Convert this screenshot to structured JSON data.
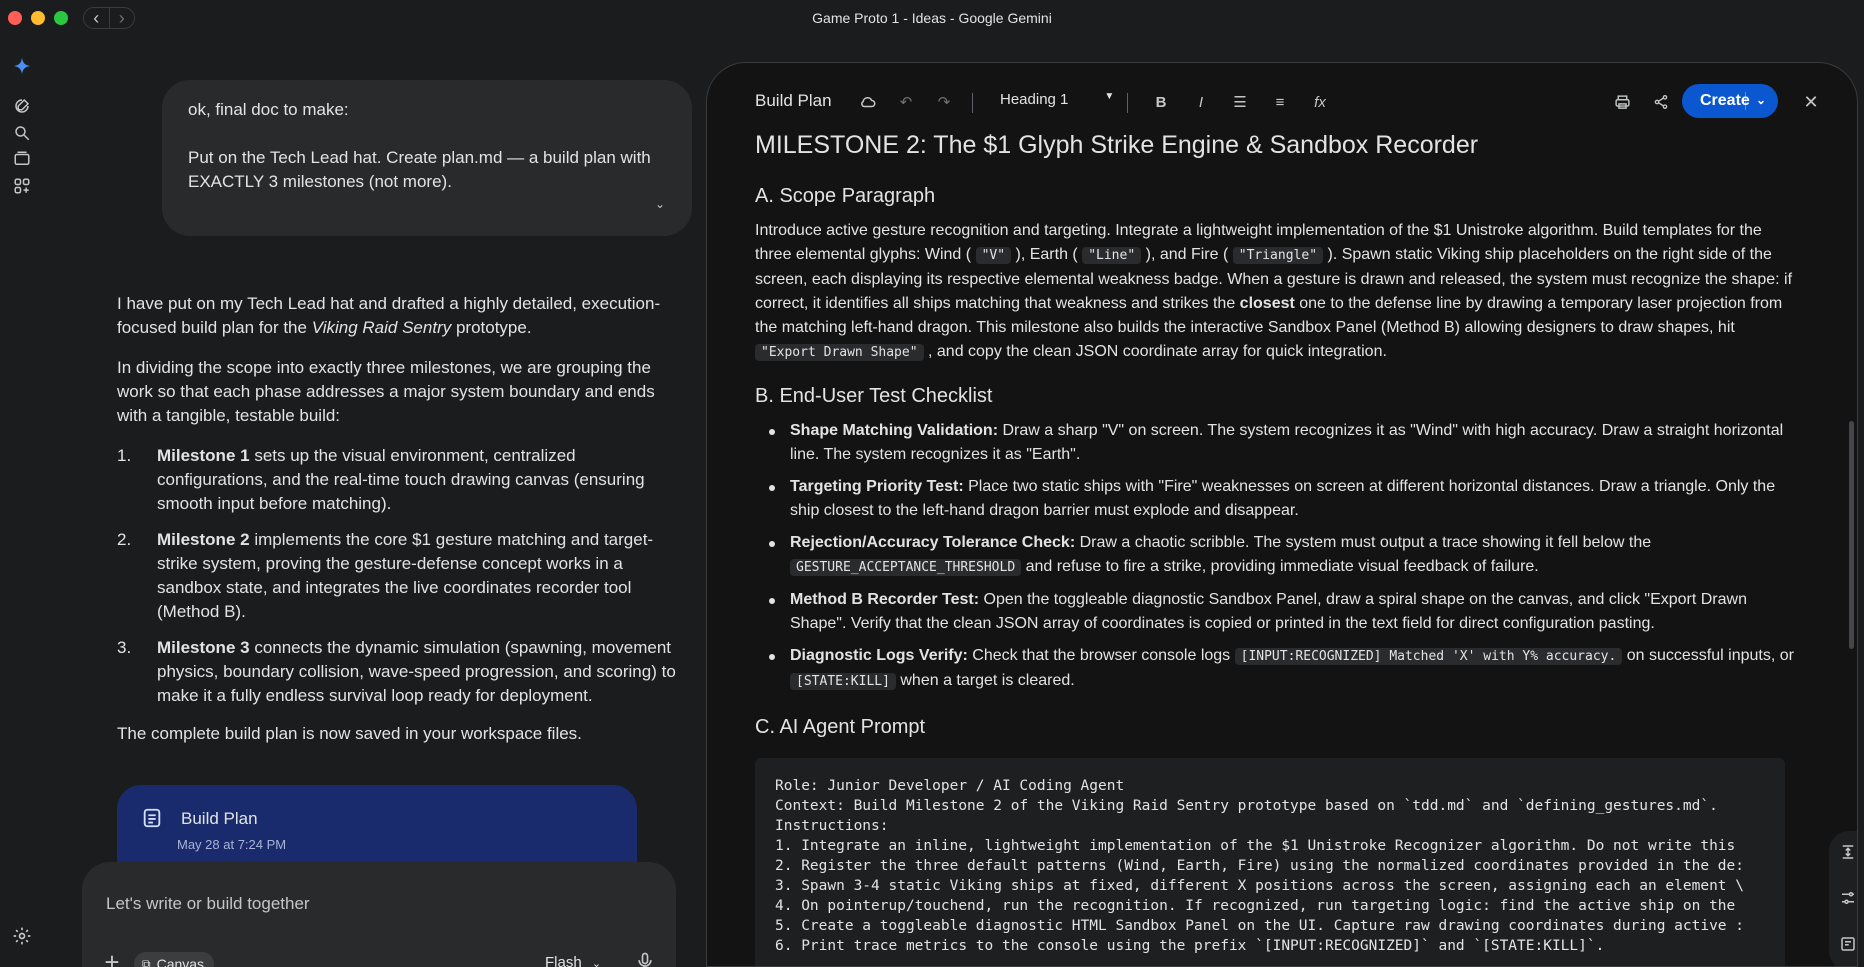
{
  "window": {
    "title": "Game Proto 1 - Ideas - Google Gemini"
  },
  "rail": {
    "icons": [
      "gemini-spark-icon",
      "new-chat-icon",
      "search-icon",
      "library-icon",
      "apps-icon",
      "settings-icon"
    ]
  },
  "chat": {
    "user_message": {
      "line1": "ok, final doc to make:",
      "line2": "Put on the Tech Lead hat. Create plan.md — a build plan with EXACTLY 3 milestones (not more)."
    },
    "response": {
      "intro_prefix": "I have put on my Tech Lead hat and drafted a highly detailed, execution-focused build plan for the ",
      "intro_italic": "Viking Raid Sentry",
      "intro_suffix": " prototype.",
      "para2": "In dividing the scope into exactly three milestones, we are grouping the work so that each phase addresses a major system boundary and ends with a tangible, testable build:",
      "milestones": [
        {
          "num": "1.",
          "title": "Milestone 1",
          "text": " sets up the visual environment, centralized configurations, and the real-time touch drawing canvas (ensuring smooth input before matching)."
        },
        {
          "num": "2.",
          "title": "Milestone 2",
          "text": " implements the core $1 gesture matching and target-strike system, proving the gesture-defense concept works in a sandbox state, and integrates the live coordinates recorder tool (Method B)."
        },
        {
          "num": "3.",
          "title": "Milestone 3",
          "text": " connects the dynamic simulation (spawning, movement physics, boundary collision, wave-speed progression, and scoring) to make it a fully endless survival loop ready for deployment."
        }
      ],
      "closing": "The complete build plan is now saved in your workspace files."
    },
    "doc_card": {
      "title": "Build Plan",
      "date": "May 28 at 7:24 PM"
    },
    "composer": {
      "placeholder": "Let's write or build together",
      "canvas_chip": "Canvas",
      "model": "Flash"
    }
  },
  "panel": {
    "toolbar": {
      "title": "Build Plan",
      "style_select": "Heading 1",
      "create_label": "Create"
    },
    "doc": {
      "h1": "MILESTONE 2: The $1 Glyph Strike Engine & Sandbox Recorder",
      "a_heading": "A. Scope Paragraph",
      "a_p1": "Introduce active gesture recognition and targeting. Integrate a lightweight implementation of the $1 Unistroke algorithm. Build templates for the three elemental glyphs: Wind (",
      "a_code_v": "\"V\"",
      "a_p2": "), Earth (",
      "a_code_line": "\"Line\"",
      "a_p3": "), and Fire (",
      "a_code_tri": "\"Triangle\"",
      "a_p4": "). Spawn static Viking ship placeholders on the right side of the screen, each displaying its respective elemental weakness badge. When a gesture is drawn and released, the system must recognize the shape: if correct, it identifies all ships matching that weakness and strikes the ",
      "a_bold": "closest",
      "a_p5": " one to the defense line by drawing a temporary laser projection from the matching left-hand dragon. This milestone also builds the interactive Sandbox Panel (Method B) allowing designers to draw shapes, hit ",
      "a_code_export": "\"Export Drawn Shape\"",
      "a_p6": ", and copy the clean JSON coordinate array for quick integration.",
      "b_heading": "B. End-User Test Checklist",
      "b_items": [
        {
          "label": "Shape Matching Validation:",
          "text": " Draw a sharp \"V\" on screen. The system recognizes it as \"Wind\" with high accuracy. Draw a straight horizontal line. The system recognizes it as \"Earth\"."
        },
        {
          "label": "Targeting Priority Test:",
          "text": " Place two static ships with \"Fire\" weaknesses on screen at different horizontal distances. Draw a triangle. Only the ship closest to the left-hand dragon barrier must explode and disappear."
        },
        {
          "label": "Rejection/Accuracy Tolerance Check:",
          "text": " Draw a chaotic scribble. The system must output a trace showing it fell below the ",
          "code": "GESTURE_ACCEPTANCE_THRESHOLD",
          "text2": " and refuse to fire a strike, providing immediate visual feedback of failure."
        },
        {
          "label": "Method B Recorder Test:",
          "text": " Open the toggleable diagnostic Sandbox Panel, draw a spiral shape on the canvas, and click \"Export Drawn Shape\". Verify that the clean JSON array of coordinates is copied or printed in the text field for direct configuration pasting."
        },
        {
          "label": "Diagnostic Logs Verify:",
          "text": " Check that the browser console logs ",
          "code": "[INPUT:RECOGNIZED] Matched 'X' with Y% accuracy.",
          "text2": " on successful inputs, or ",
          "code2": "[STATE:KILL]",
          "text3": " when a target is cleared."
        }
      ],
      "c_heading": "C. AI Agent Prompt",
      "code_lines": [
        "Role: Junior Developer / AI Coding Agent",
        "Context: Build Milestone 2 of the Viking Raid Sentry prototype based on `tdd.md` and `defining_gestures.md`.",
        "Instructions:",
        "1. Integrate an inline, lightweight implementation of the $1 Unistroke Recognizer algorithm. Do not write this",
        "2. Register the three default patterns (Wind, Earth, Fire) using the normalized coordinates provided in the de:",
        "3. Spawn 3-4 static Viking ships at fixed, different X positions across the screen, assigning each an element \\",
        "4. On pointerup/touchend, run the recognition. If recognized, run targeting logic: find the active ship on the",
        "5. Create a toggleable diagnostic HTML Sandbox Panel on the UI. Capture raw drawing coordinates during active :",
        "6. Print trace metrics to the console using the prefix `[INPUT:RECOGNIZED]` and `[STATE:KILL]`."
      ]
    }
  },
  "colors": {
    "accent": "#0b57d0",
    "doc_card": "#1a2b6d",
    "background": "#1b1c1d",
    "panel": "#131314"
  }
}
